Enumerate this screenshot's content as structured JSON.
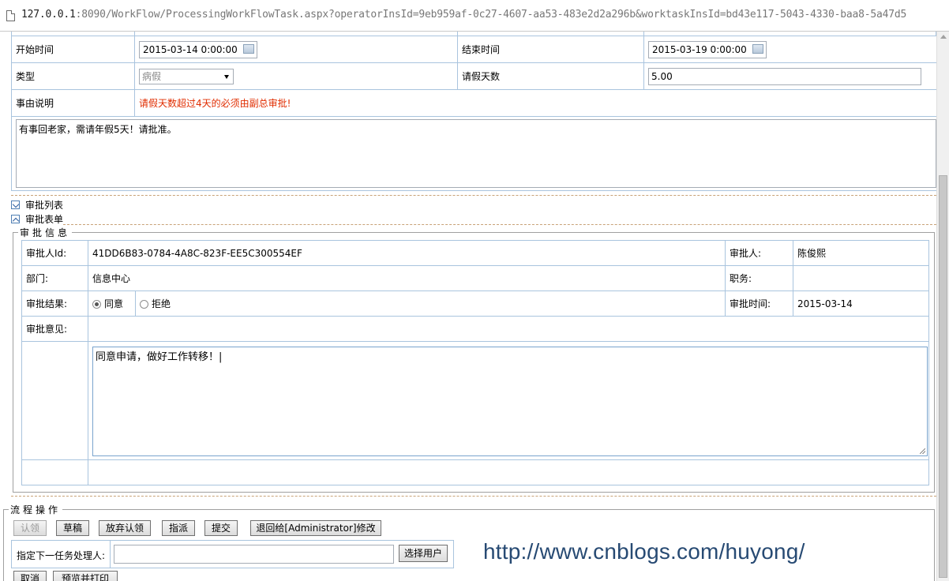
{
  "browser": {
    "url_host": "127.0.0.1",
    "url_rest": ":8090/WorkFlow/ProcessingWorkFlowTask.aspx?operatorInsId=9eb959af-0c27-4607-aa53-483e2d2a296b&worktaskInsId=bd43e117-5043-4330-baa8-5a47d5"
  },
  "leave_form": {
    "start_label": "开始时间",
    "start_value": "2015-03-14 0:00:00",
    "end_label": "结束时间",
    "end_value": "2015-03-19 0:00:00",
    "type_label": "类型",
    "type_value": "病假",
    "days_label": "请假天数",
    "days_value": "5.00",
    "reason_label": "事由说明",
    "reason_note": "请假天数超过4天的必须由副总审批!",
    "reason_text": "有事回老家，需请年假5天！请批准。"
  },
  "sections": {
    "approval_list": "审批列表",
    "approval_form": "审批表单"
  },
  "approval": {
    "legend": "审批信息",
    "approver_id_label": "审批人Id:",
    "approver_id": "41DD6B83-0784-4A8C-823F-EE5C300554EF",
    "approver_label": "审批人:",
    "approver": "陈俊熙",
    "dept_label": "部门:",
    "dept": "信息中心",
    "position_label": "职务:",
    "position": "",
    "result_label": "审批结果:",
    "agree_label": "同意",
    "reject_label": "拒绝",
    "result_selected": "agree",
    "time_label": "审批时间:",
    "time": "2015-03-14",
    "opinion_label": "审批意见:",
    "opinion_text": "同意申请，做好工作转移！|"
  },
  "process": {
    "legend": "流程操作",
    "buttons": {
      "claim": "认领",
      "draft": "草稿",
      "abandon": "放弃认领",
      "assign": "指派",
      "submit": "提交",
      "return": "退回给[Administrator]修改",
      "cancel": "取消",
      "preview_print": "预览并打印"
    },
    "next_handler_label": "指定下一任务处理人:",
    "next_handler_value": "",
    "select_user": "选择用户"
  },
  "watermark": "http://www.cnblogs.com/huyong/"
}
